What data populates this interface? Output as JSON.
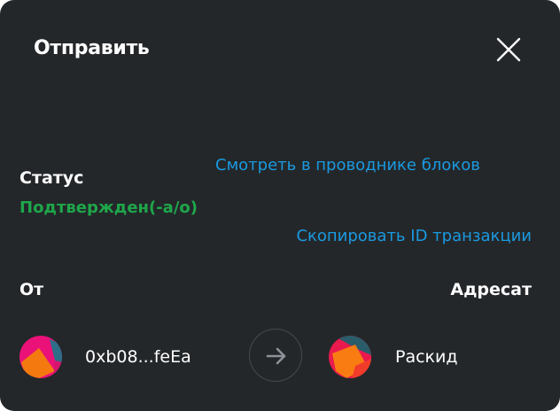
{
  "modal": {
    "title": "Отправить",
    "close_icon": "close-icon"
  },
  "status": {
    "label": "Статус",
    "value": "Подтвержден(-а/о)",
    "value_color": "#1ea64a"
  },
  "links": {
    "explorer": "Смотреть в проводнике блоков",
    "copy_tx": "Скопировать ID транзакции",
    "color": "#1a9ae0"
  },
  "from": {
    "label": "От",
    "address": "0xb08...feEa"
  },
  "to": {
    "label": "Адресат",
    "name": "Раскид"
  },
  "transfer_icon": "arrow-right-icon"
}
